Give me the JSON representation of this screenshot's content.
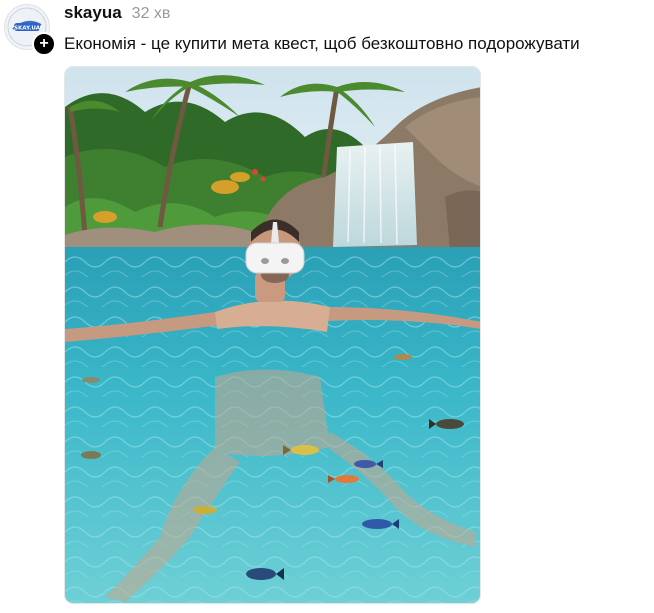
{
  "post": {
    "username": "skayua",
    "timestamp": "32 хв",
    "caption": "Економія - це купити мета квест, щоб безкоштовно подорожувати",
    "avatar_logo_text": "SKAY.UA",
    "follow_symbol": "+"
  },
  "colors": {
    "water": "#33b3c6",
    "sky": "#dfeef5",
    "foliage": "#3f7a2e",
    "rock": "#8f7c6a",
    "headset": "#f4f4f4"
  },
  "icons": {
    "follow": "plus-icon",
    "avatar": "skay-logo-icon"
  }
}
